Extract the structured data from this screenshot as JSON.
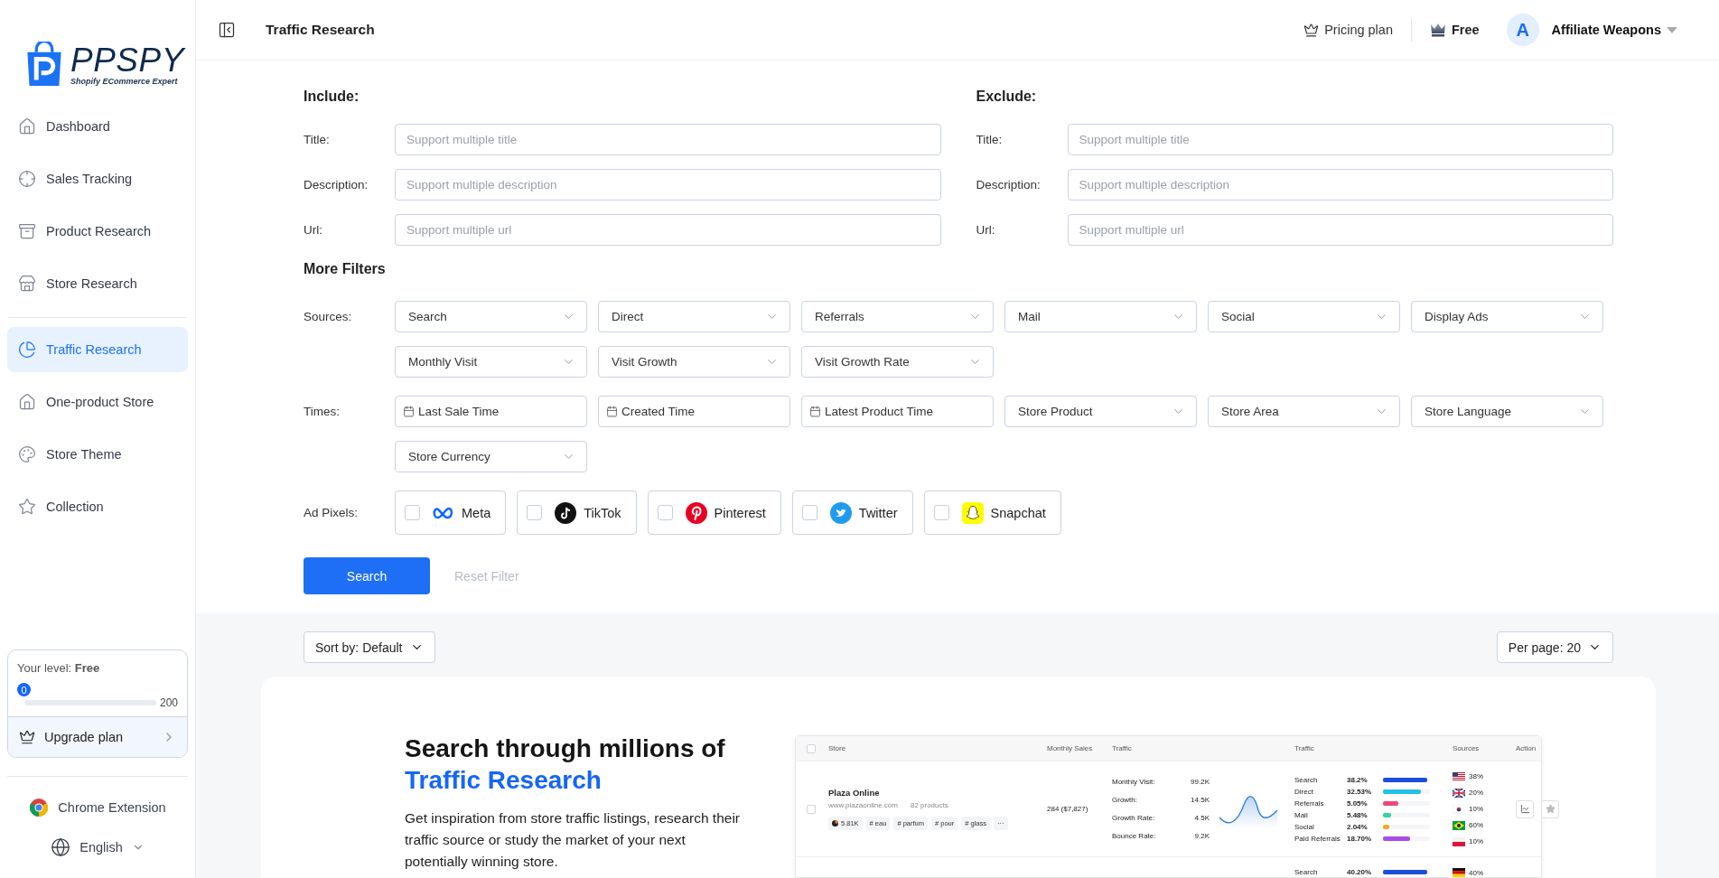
{
  "logo": {
    "name": "**PP**SPY",
    "tagline": "Shopify ECommerce Expert"
  },
  "sidebar": {
    "sections": [
      {
        "items": [
          {
            "kind": "home",
            "label": "Dashboard",
            "selected": false
          },
          {
            "kind": "target",
            "label": "Sales Tracking",
            "selected": false
          },
          {
            "kind": "archive",
            "label": "Product Research",
            "selected": false
          },
          {
            "kind": "store",
            "label": "Store Research",
            "selected": false
          }
        ]
      },
      {
        "items": [
          {
            "kind": "pie",
            "label": "Traffic Research",
            "selected": true
          },
          {
            "kind": "house",
            "label": "One-product Store",
            "selected": false
          },
          {
            "kind": "palette",
            "label": "Store Theme",
            "selected": false
          },
          {
            "kind": "star",
            "label": "Collection",
            "selected": false
          }
        ]
      }
    ],
    "level_card": {
      "label": "Your level: **Free**",
      "points": "0",
      "max": "200",
      "level": 0,
      "upgrade": "Upgrade plan"
    },
    "chrome_extension": "Chrome Extension",
    "language": "English"
  },
  "header": {
    "title": "Traffic Research",
    "pricing": "Pricing plan",
    "plan": "Free",
    "avatar": "A",
    "user": "Affiliate Weapons"
  },
  "include": {
    "heading": "Include:",
    "fields": [
      {
        "label": "Title:",
        "placeholder": "Support multiple title"
      },
      {
        "label": "Description:",
        "placeholder": "Support multiple description"
      },
      {
        "label": "Url:",
        "placeholder": "Support multiple url"
      }
    ]
  },
  "exclude": {
    "heading": "Exclude:",
    "fields": [
      {
        "label": "Title:",
        "placeholder": "Support multiple title"
      },
      {
        "label": "Description:",
        "placeholder": "Support multiple description"
      },
      {
        "label": "Url:",
        "placeholder": "Support multiple url"
      }
    ]
  },
  "more_filters": {
    "heading": "More Filters",
    "groups": [
      {
        "label": "Sources:",
        "controls": [
          {
            "kind": "select",
            "label": "Search"
          },
          {
            "kind": "select",
            "label": "Direct"
          },
          {
            "kind": "select",
            "label": "Referrals"
          },
          {
            "kind": "select",
            "label": "Mail"
          },
          {
            "kind": "select",
            "label": "Social"
          },
          {
            "kind": "select",
            "label": "Display Ads"
          },
          {
            "kind": "select",
            "label": "Monthly Visit"
          },
          {
            "kind": "select",
            "label": "Visit Growth"
          },
          {
            "kind": "select",
            "label": "Visit Growth Rate"
          }
        ]
      },
      {
        "label": "Times:",
        "controls": [
          {
            "kind": "date",
            "label": "Last Sale Time"
          },
          {
            "kind": "date",
            "label": "Created Time"
          },
          {
            "kind": "date",
            "label": "Latest Product Time"
          },
          {
            "kind": "select",
            "label": "Store Product"
          },
          {
            "kind": "select",
            "label": "Store Area"
          },
          {
            "kind": "select",
            "label": "Store Language"
          },
          {
            "kind": "select",
            "label": "Store Currency"
          }
        ]
      }
    ]
  },
  "ad_pixels": {
    "label": "Ad Pixels:",
    "items": [
      {
        "kind": "meta",
        "label": "Meta",
        "checked": false
      },
      {
        "kind": "tiktok",
        "label": "TikTok",
        "checked": false
      },
      {
        "kind": "pinterest",
        "label": "Pinterest",
        "checked": false
      },
      {
        "kind": "twitter",
        "label": "Twitter",
        "checked": false
      },
      {
        "kind": "snapchat",
        "label": "Snapchat",
        "checked": false
      }
    ]
  },
  "actions": {
    "search": "Search",
    "reset": "Reset Filter"
  },
  "sort": "Sort by: Default",
  "per_page": "Per page: 20",
  "promo": {
    "heading": "Search through millions of",
    "highlight": "Traffic Research",
    "body": "Get inspiration from store traffic listings, research their traffic source or study the market of your next potentially winning store."
  },
  "preview": {
    "header_checked": false,
    "columns": [
      "Store",
      "Monthly Sales",
      "Traffic",
      "Traffic",
      "Sources",
      "Action"
    ],
    "rows": [
      {
        "checked": false,
        "store": "Plaza Online",
        "url": "www.plazaonline.com",
        "products": "82 products",
        "tags": [
          {
            "kind": "visits",
            "text": "5.81K"
          },
          {
            "kind": "keyword",
            "text": "# eau"
          },
          {
            "kind": "keyword",
            "text": "# parfum"
          },
          {
            "kind": "keyword",
            "text": "# pour"
          },
          {
            "kind": "keyword",
            "text": "# glass"
          },
          {
            "kind": "keyword",
            "text": "···"
          }
        ],
        "sales": "284 ($7,827)",
        "stats": [
          {
            "label": "Monthly Visit:",
            "value": "99.2K"
          },
          {
            "label": "Growth:",
            "value": "14.5K"
          },
          {
            "label": "Growth Rate:",
            "value": "4.5K"
          },
          {
            "label": "Bounce Rate:",
            "value": "9.2K"
          }
        ],
        "sources": [
          {
            "name": "Search",
            "share": "38.2%",
            "level": 0.94,
            "color": "#1d4ed8"
          },
          {
            "name": "Direct",
            "share": "32.53%",
            "level": 0.8,
            "color": "#22c1e6"
          },
          {
            "name": "Referrals",
            "share": "5.05%",
            "level": 0.33,
            "color": "#f0457a"
          },
          {
            "name": "Mail",
            "share": "5.48%",
            "level": 0.18,
            "color": "#34d3a0"
          },
          {
            "name": "Social",
            "share": "2.04%",
            "level": 0.14,
            "color": "#f5a524"
          },
          {
            "name": "Paid Referrals",
            "share": "18.70%",
            "level": 0.58,
            "color": "#a64ee6"
          }
        ],
        "countries": [
          {
            "kind": "us",
            "share": "38%"
          },
          {
            "kind": "uk",
            "share": "20%"
          },
          {
            "kind": "kr",
            "share": "10%"
          },
          {
            "kind": "br",
            "share": "60%"
          },
          {
            "kind": "pl",
            "share": "10%"
          }
        ]
      },
      {
        "sources": [
          {
            "name": "Search",
            "share": "40.20%",
            "level": 0.94,
            "color": "#1d4ed8"
          }
        ],
        "countries": [
          {
            "kind": "de",
            "share": "40%"
          }
        ]
      }
    ]
  }
}
